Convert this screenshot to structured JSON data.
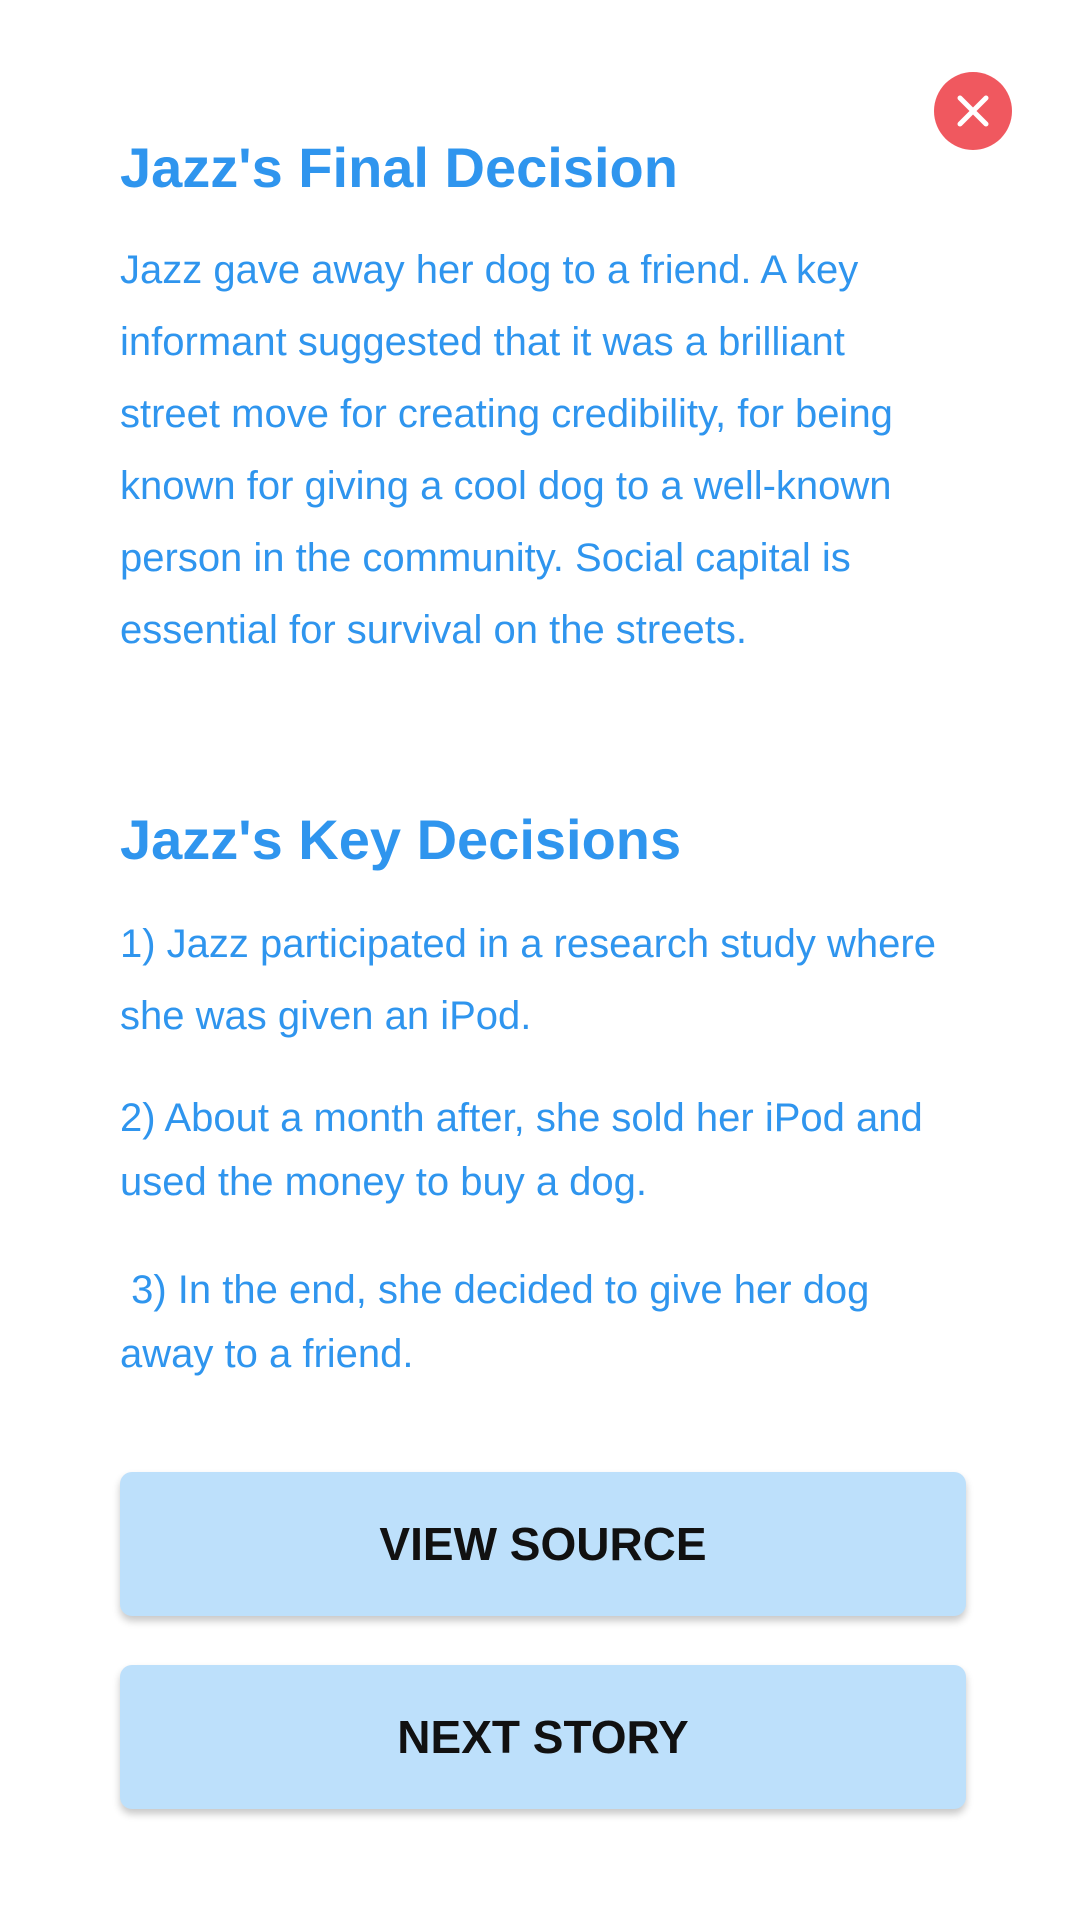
{
  "close": {
    "icon": "close-icon"
  },
  "final_decision": {
    "title": "Jazz's Final Decision",
    "body": "Jazz gave away her dog to a friend. A key informant suggested that it was a brilliant street move for creating credibility, for being known for giving a cool dog to a well-known person in the community. Social capital is essential for survival on the streets."
  },
  "key_decisions": {
    "title": "Jazz's Key Decisions",
    "items": [
      "1) Jazz participated in a research study where she was given an iPod.",
      "2) About a month after, she sold her iPod and used the money to buy a dog.",
      " 3) In the end, she decided to give her dog away to a friend."
    ]
  },
  "buttons": {
    "view_source": "VIEW SOURCE",
    "next_story": "NEXT STORY"
  },
  "colors": {
    "text_accent": "#2f95ee",
    "close_button": "#f0585f",
    "button_background": "#bde0fb",
    "button_text": "#111111"
  }
}
